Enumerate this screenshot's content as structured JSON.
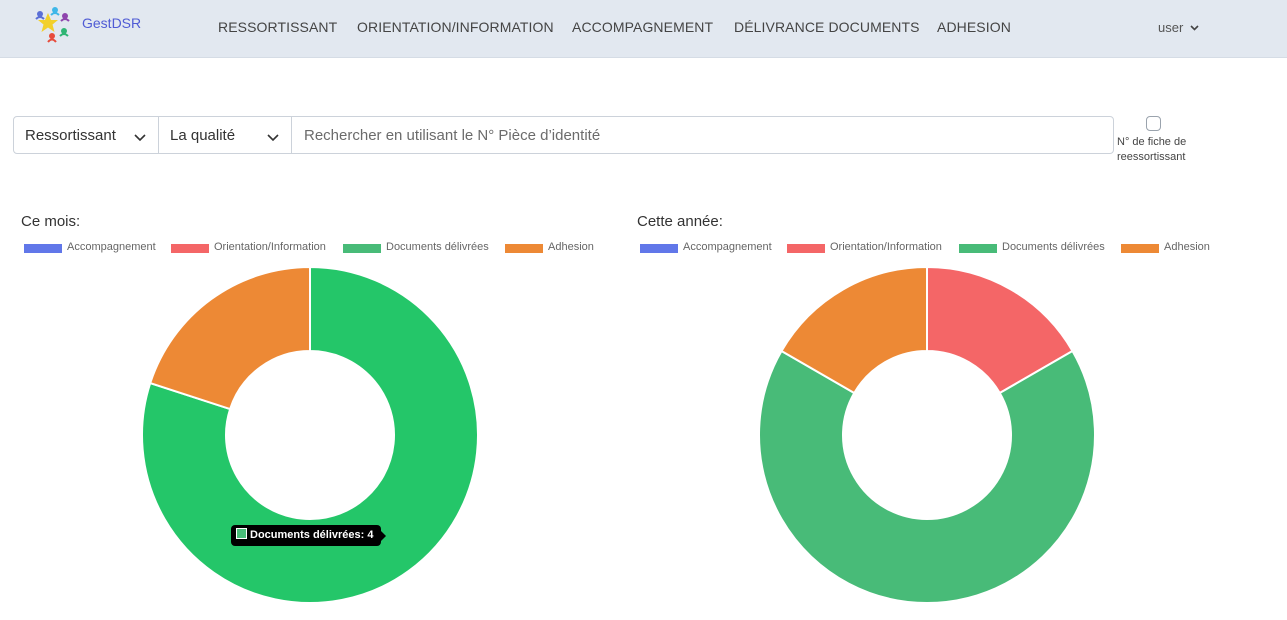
{
  "app": {
    "brand": "GestDSR"
  },
  "nav": {
    "items": [
      {
        "label": "RESSORTISSANT"
      },
      {
        "label": "ORIENTATION/INFORMATION"
      },
      {
        "label": "ACCOMPAGNEMENT"
      },
      {
        "label": "DÉLIVRANCE DOCUMENTS"
      },
      {
        "label": "ADHESION"
      }
    ],
    "user": "user"
  },
  "search": {
    "type_select": "Ressortissant",
    "quality_select": "La qualité",
    "placeholder": "Rechercher en utilisant le N° Pièce d’identité",
    "value": "",
    "checkbox_label": "N° de fiche de reessortissant",
    "checkbox_checked": false
  },
  "icons": {
    "user_menu": "chevron-down-icon",
    "select": "chevron-down-icon",
    "logo": "people-star-logo-icon"
  },
  "colors": {
    "Accompagnement": "#6177e9",
    "Orientation/Information": "#f46667",
    "Documents délivrées": "#24c669",
    "Documents délivrées (année)": "#48bb78",
    "Adhesion": "#ed8935",
    "brand": "#4f5bd5",
    "navbar": "#e2e8f0"
  },
  "tooltip": {
    "label": "Documents délivrées",
    "value": 4
  },
  "chart_data": [
    {
      "type": "pie",
      "title": "Ce mois:",
      "donut": true,
      "legend_position": "top",
      "categories": [
        "Accompagnement",
        "Orientation/Information",
        "Documents délivrées",
        "Adhesion"
      ],
      "values": [
        0,
        0,
        4,
        1
      ]
    },
    {
      "type": "pie",
      "title": "Cette année:",
      "donut": true,
      "legend_position": "top",
      "categories": [
        "Accompagnement",
        "Orientation/Information",
        "Documents délivrées",
        "Adhesion"
      ],
      "values": [
        0,
        1,
        4,
        1
      ]
    }
  ]
}
